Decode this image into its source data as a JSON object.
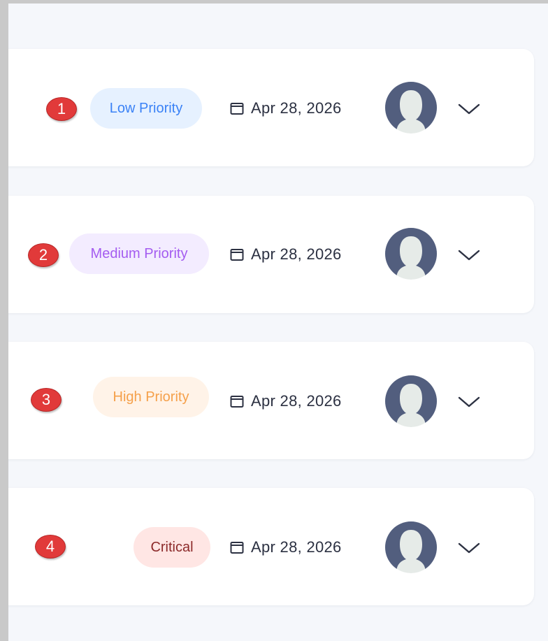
{
  "tasks": [
    {
      "number": "1",
      "priority": {
        "label": "Low Priority",
        "bg": "#e6f1ff",
        "color": "#3b82f6"
      },
      "date": "Apr 28, 2026"
    },
    {
      "number": "2",
      "priority": {
        "label": "Medium Priority",
        "bg": "#f3ecff",
        "color": "#a45cf0"
      },
      "date": "Apr 28, 2026"
    },
    {
      "number": "3",
      "priority": {
        "label": "High Priority",
        "bg": "#fff3e8",
        "color": "#f5a04a"
      },
      "date": "Apr 28, 2026"
    },
    {
      "number": "4",
      "priority": {
        "label": "Critical",
        "bg": "#ffe6e4",
        "color": "#8c2a2a"
      },
      "date": "Apr 28, 2026"
    }
  ],
  "icons": {
    "date": "calendar-icon",
    "assignee": "avatar-placeholder",
    "expand": "chevron-down-icon"
  },
  "colors": {
    "badge": "#e13a3a",
    "avatar": "#525e7e",
    "background": "#f5f7fb"
  }
}
